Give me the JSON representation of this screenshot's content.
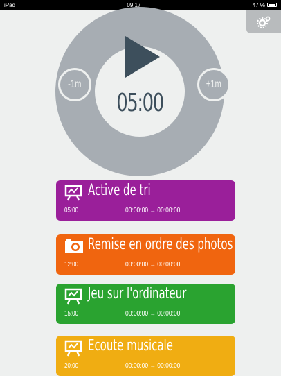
{
  "status": {
    "carrier": "iPad",
    "time": "09:17",
    "battery": "47 %"
  },
  "timer": {
    "display": "05:00",
    "minus_label": "-1m",
    "plus_label": "+1m"
  },
  "tasks": [
    {
      "title": "Active de tri",
      "duration": "05:00",
      "range": "00:00:00 → 00:00:00",
      "color": "#9a1f9a",
      "icon": "easel-icon"
    },
    {
      "title": "Remise en ordre des photos",
      "duration": "12:00",
      "range": "00:00:00 → 00:00:00",
      "color": "#f0650f",
      "icon": "camera-icon"
    },
    {
      "title": "Jeu sur l'ordinateur",
      "duration": "15:00",
      "range": "00:00:00 → 00:00:00",
      "color": "#2aa330",
      "icon": "easel-icon"
    },
    {
      "title": "Ecoute musicale",
      "duration": "20:00",
      "range": "00:00:00 → 00:00:00",
      "color": "#f0ad12",
      "icon": "easel-icon"
    }
  ]
}
